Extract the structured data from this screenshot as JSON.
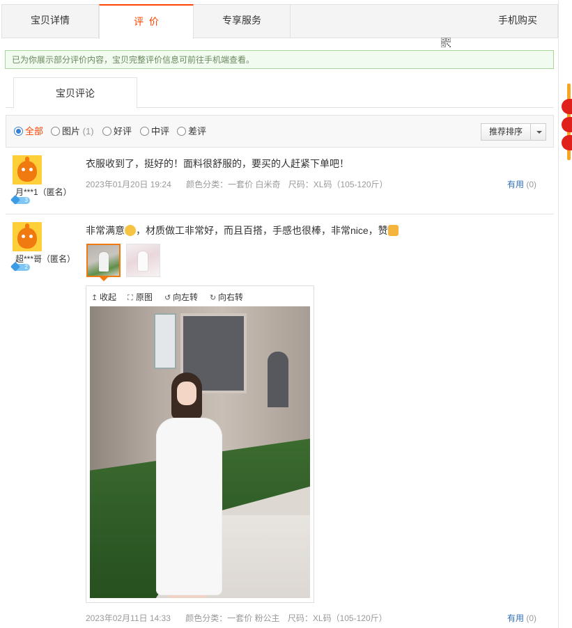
{
  "tabs": [
    {
      "label": "宝贝详情"
    },
    {
      "label": "评  价"
    },
    {
      "label": "专享服务"
    },
    {
      "label": "手机购买"
    }
  ],
  "notice": "已为你展示部分评价内容，宝贝完整评价信息可前往手机端查看。",
  "subtab": "宝贝评论",
  "filters": {
    "all": "全部",
    "pic": "图片",
    "pic_count": "(1)",
    "good": "好评",
    "mid": "中评",
    "bad": "差评",
    "sort": "推荐排序"
  },
  "reviews": [
    {
      "user": "月***1（匿名）",
      "level": "3",
      "content": "衣服收到了，挺好的！面料很舒服的，要买的人赶紧下单吧！",
      "date": "2023年01月20日 19:24",
      "color": "颜色分类：一套价 白米奇",
      "size": "尺码：XL码（105-120斤）",
      "useful": "有用",
      "useful_count": "(0)"
    },
    {
      "user": "超***哥（匿名）",
      "level": "2",
      "content_a": "非常满意",
      "content_b": "，材质做工非常好，而且百搭，手感也很棒，非常nice，赞",
      "date": "2023年02月11日 14:33",
      "color": "颜色分类：一套价 粉公主",
      "size": "尺码：XL码（105-120斤）",
      "useful": "有用",
      "useful_count": "(0)",
      "viewer": {
        "collapse": "收起",
        "original": "原图",
        "rotate_left": "向左转",
        "rotate_right": "向右转"
      }
    }
  ],
  "colors": {
    "accent": "#ff4400",
    "link": "#2f6fb6",
    "notice_border": "#a6d59a"
  }
}
